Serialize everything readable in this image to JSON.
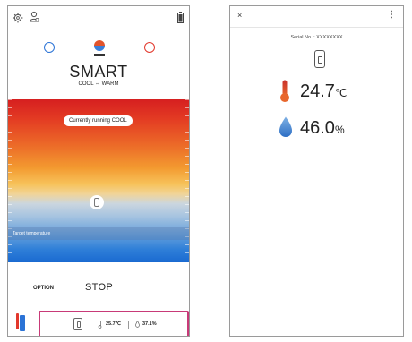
{
  "left_screen": {
    "mode": {
      "title": "SMART",
      "subtitle": "COOL ⇔ WARM"
    },
    "status_pill": "Currently running COOL",
    "target_label": "Target temperature",
    "buttons": {
      "option": "OPTION",
      "stop": "STOP"
    },
    "sensor_card": {
      "temperature": "25.7℃",
      "humidity": "37.1%"
    },
    "colors": {
      "cool": "#2b73d6",
      "warm": "#e2382c",
      "highlight": "#c83a78"
    }
  },
  "right_screen": {
    "header": {
      "close_icon": "×",
      "more_icon": "⋮"
    },
    "serial_label": "Serial No. : XXXXXXXX",
    "temperature_value": "24.7",
    "temperature_unit": "℃",
    "humidity_value": "46.0",
    "humidity_unit": "%"
  }
}
